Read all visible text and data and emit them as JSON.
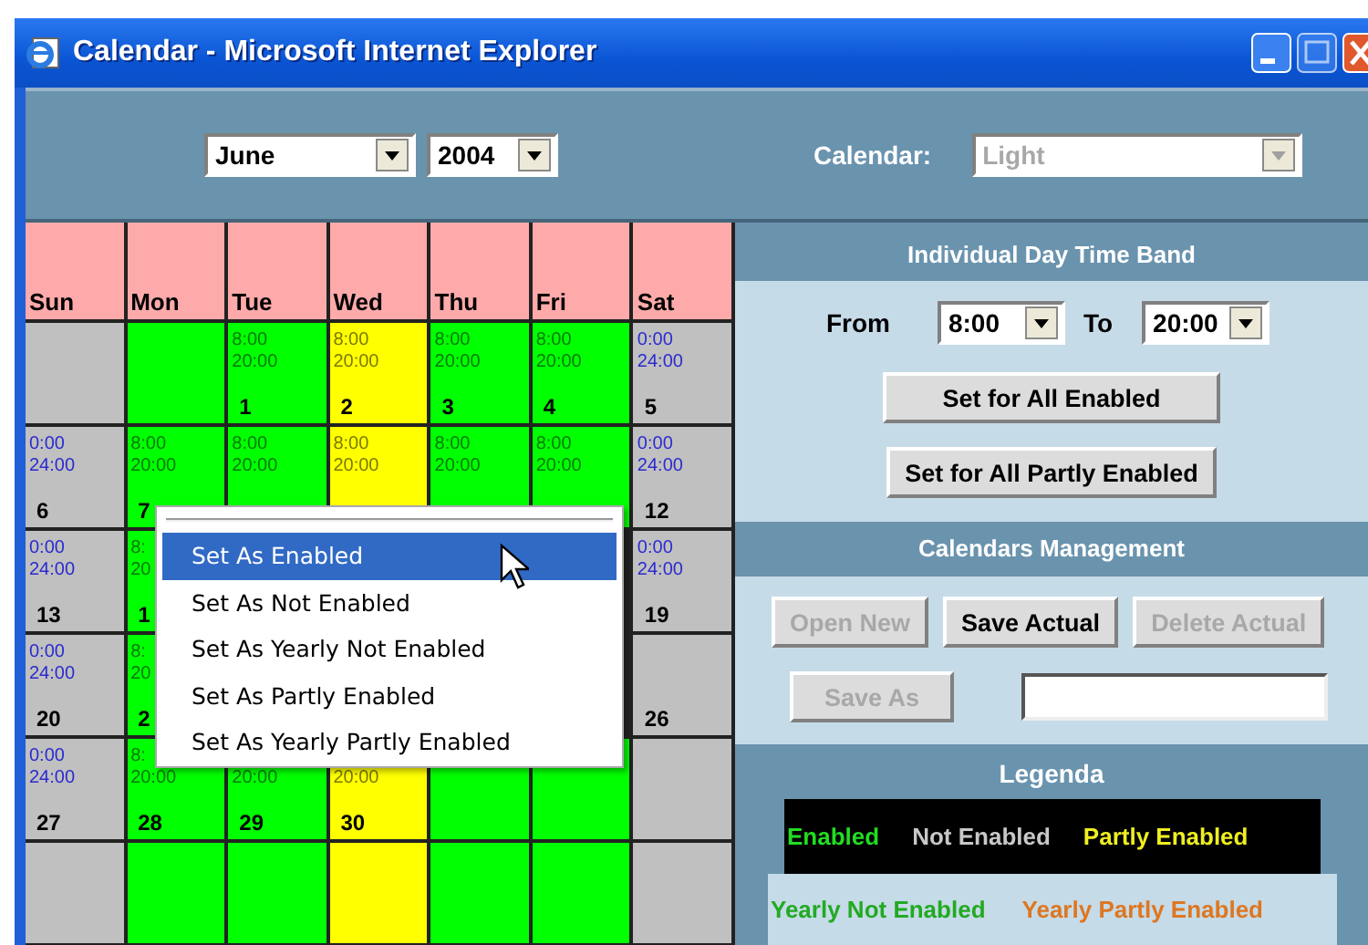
{
  "window": {
    "title": "Calendar - Microsoft Internet Explorer"
  },
  "toolbar": {
    "month": "June",
    "year": "2004",
    "calendar_label": "Calendar:",
    "calendar_select": {
      "value": "Light",
      "disabled": true
    }
  },
  "calendar": {
    "weekdays": [
      "Sun",
      "Mon",
      "Tue",
      "Wed",
      "Thu",
      "Fri",
      "Sat"
    ],
    "weeks": [
      [
        {
          "kind": "day",
          "color": "#c0c0c0"
        },
        {
          "kind": "day",
          "color": "#00ff00"
        },
        {
          "kind": "day",
          "color": "#00ff00",
          "time_from": "8:00",
          "time_to": "20:00",
          "date": "1"
        },
        {
          "kind": "day",
          "color": "#ffff00",
          "time_from": "8:00",
          "time_to": "20:00",
          "date": "2"
        },
        {
          "kind": "day",
          "color": "#00ff00",
          "time_from": "8:00",
          "time_to": "20:00",
          "date": "3"
        },
        {
          "kind": "day",
          "color": "#00ff00",
          "time_from": "8:00",
          "time_to": "20:00",
          "date": "4"
        },
        {
          "kind": "day",
          "color": "#c0c0c0",
          "time_from": "0:00",
          "time_to": "24:00",
          "date": "5"
        }
      ],
      [
        {
          "kind": "day",
          "color": "#c0c0c0",
          "time_from": "0:00",
          "time_to": "24:00",
          "date": "6"
        },
        {
          "kind": "day",
          "color": "#00ff00",
          "time_from": "8:00",
          "time_to": "20:00",
          "date": "7"
        },
        {
          "kind": "day",
          "color": "#00ff00",
          "time_from": "8:00",
          "time_to": "20:00"
        },
        {
          "kind": "day",
          "color": "#ffff00",
          "time_from": "8:00",
          "time_to": "20:00"
        },
        {
          "kind": "day",
          "color": "#00ff00",
          "time_from": "8:00",
          "time_to": "20:00"
        },
        {
          "kind": "day",
          "color": "#00ff00",
          "time_from": "8:00",
          "time_to": "20:00"
        },
        {
          "kind": "day",
          "color": "#c0c0c0",
          "time_from": "0:00",
          "time_to": "24:00",
          "date": "12"
        }
      ],
      [
        {
          "kind": "day",
          "color": "#c0c0c0",
          "time_from": "0:00",
          "time_to": "24:00",
          "date": "13"
        },
        {
          "kind": "day",
          "color": "#00ff00",
          "time_from": "8:",
          "time_to": "20",
          "date": "1"
        },
        {
          "kind": "covered"
        },
        {
          "kind": "covered"
        },
        {
          "kind": "covered"
        },
        {
          "kind": "covered"
        },
        {
          "kind": "day",
          "color": "#c0c0c0",
          "time_from": "0:00",
          "time_to": "24:00",
          "date": "19"
        }
      ],
      [
        {
          "kind": "day",
          "color": "#c0c0c0",
          "time_from": "0:00",
          "time_to": "24:00",
          "date": "20"
        },
        {
          "kind": "day",
          "color": "#00ff00",
          "time_from": "8:",
          "time_to": "20",
          "date": "2"
        },
        {
          "kind": "covered"
        },
        {
          "kind": "covered"
        },
        {
          "kind": "covered"
        },
        {
          "kind": "covered"
        },
        {
          "kind": "day",
          "color": "#c0c0c0",
          "date": "26"
        }
      ],
      [
        {
          "kind": "day",
          "color": "#c0c0c0",
          "time_from": "0:00",
          "time_to": "24:00",
          "date": "27"
        },
        {
          "kind": "day",
          "color": "#00ff00",
          "time_from": "8:",
          "time_to": "20:00",
          "date": "28"
        },
        {
          "kind": "day",
          "color": "#00ff00",
          "time_to": "20:00",
          "date": "29"
        },
        {
          "kind": "day",
          "color": "#ffff00",
          "time_to": "20:00",
          "date": "30"
        },
        {
          "kind": "day",
          "color": "#00ff00"
        },
        {
          "kind": "day",
          "color": "#00ff00"
        },
        {
          "kind": "day",
          "color": "#c0c0c0"
        }
      ],
      [
        {
          "kind": "day",
          "color": "#c0c0c0"
        },
        {
          "kind": "day",
          "color": "#00ff00"
        },
        {
          "kind": "day",
          "color": "#00ff00"
        },
        {
          "kind": "day",
          "color": "#ffff00"
        },
        {
          "kind": "day",
          "color": "#00ff00"
        },
        {
          "kind": "day",
          "color": "#00ff00"
        },
        {
          "kind": "day",
          "color": "#c0c0c0"
        }
      ]
    ]
  },
  "context_menu": {
    "items": [
      {
        "label": "Set As Enabled",
        "selected": true
      },
      {
        "label": "Set As Not Enabled",
        "selected": false
      },
      {
        "label": "Set As Yearly Not Enabled",
        "selected": false
      },
      {
        "label": "Set As Partly Enabled",
        "selected": false
      },
      {
        "label": "Set As Yearly Partly Enabled",
        "selected": false
      }
    ]
  },
  "time_band": {
    "title": "Individual Day Time Band",
    "from_label": "From",
    "from_value": "8:00",
    "to_label": "To",
    "to_value": "20:00",
    "buttons": [
      "Set for All Enabled",
      "Set for All Partly Enabled"
    ]
  },
  "management": {
    "title": "Calendars Management",
    "buttons": [
      {
        "label": "Open New",
        "disabled": true
      },
      {
        "label": "Save Actual",
        "disabled": false
      },
      {
        "label": "Delete Actual",
        "disabled": true
      }
    ],
    "save_as": {
      "label": "Save As",
      "disabled": true
    }
  },
  "legend": {
    "title": "Legenda",
    "rows": [
      [
        {
          "label": "Enabled",
          "color": "#22dd22"
        },
        {
          "label": "Not Enabled",
          "color": "#c8c8c8"
        },
        {
          "label": "Partly Enabled",
          "color": "#eeee22"
        }
      ],
      [
        {
          "label": "Yearly Not Enabled",
          "color": "#22aa22"
        },
        {
          "label": "Yearly Partly Enabled",
          "color": "#dd7722"
        }
      ]
    ]
  }
}
